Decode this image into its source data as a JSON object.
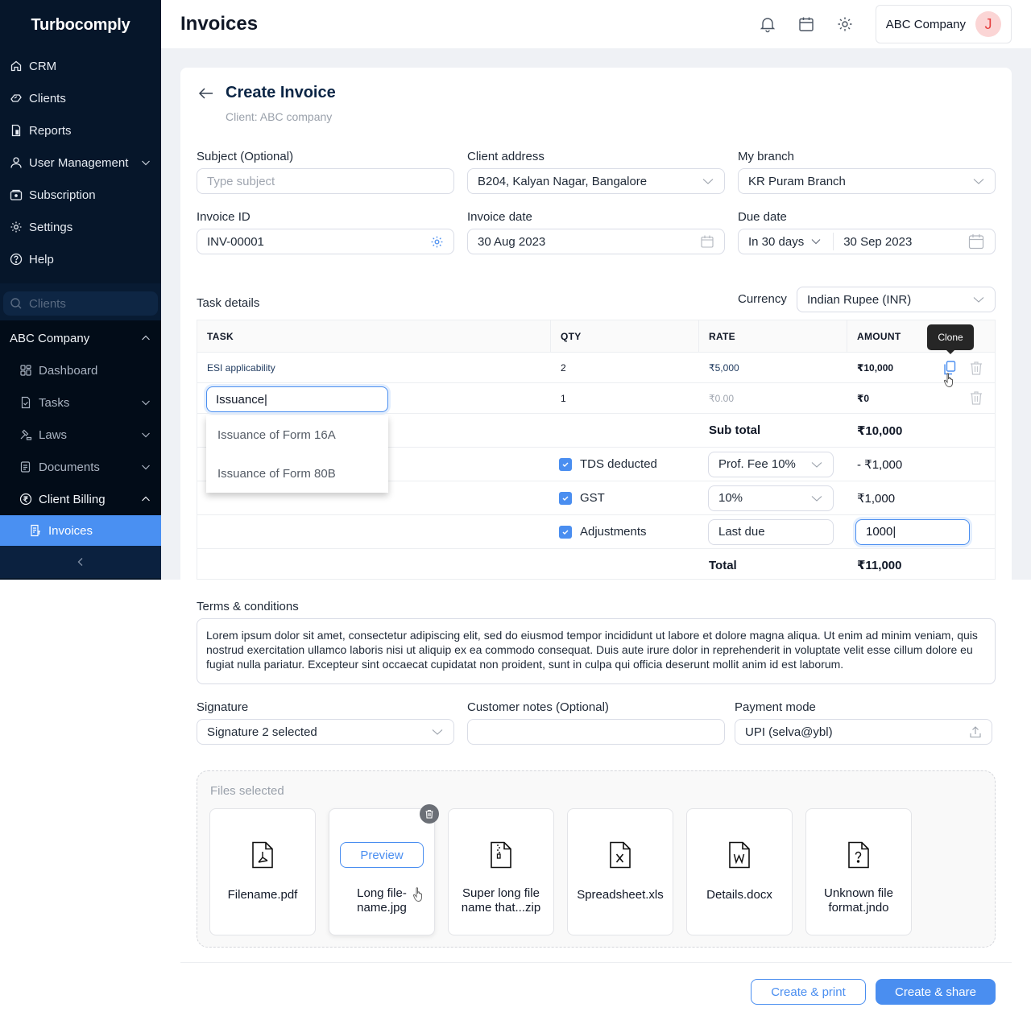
{
  "app": {
    "brand": "Turbocomply",
    "page_title": "Invoices"
  },
  "sidebar": {
    "items": [
      {
        "label": "CRM",
        "icon": "home-icon"
      },
      {
        "label": "Clients",
        "icon": "handshake-icon"
      },
      {
        "label": "Reports",
        "icon": "report-icon"
      },
      {
        "label": "User Management",
        "icon": "user-icon",
        "expandable": true
      },
      {
        "label": "Subscription",
        "icon": "subscription-icon"
      },
      {
        "label": "Settings",
        "icon": "gear-icon"
      },
      {
        "label": "Help",
        "icon": "help-icon"
      }
    ],
    "search_placeholder": "Clients",
    "company": {
      "name": "ABC Company",
      "items": [
        {
          "label": "Dashboard",
          "icon": "dashboard-icon"
        },
        {
          "label": "Tasks",
          "icon": "tasks-icon"
        },
        {
          "label": "Laws",
          "icon": "gavel-icon"
        },
        {
          "label": "Documents",
          "icon": "documents-icon"
        },
        {
          "label": "Client Billing",
          "icon": "rupee-icon"
        }
      ],
      "active_sub_item": "Invoices"
    }
  },
  "header": {
    "account_name": "ABC Company",
    "avatar_initial": "J"
  },
  "form": {
    "title": "Create Invoice",
    "client_label": "Client: ABC company",
    "subject": {
      "label": "Subject (Optional)",
      "placeholder": "Type subject",
      "value": ""
    },
    "client_address": {
      "label": "Client address",
      "value": "B204, Kalyan Nagar, Bangalore"
    },
    "branch": {
      "label": "My branch",
      "value": "KR Puram Branch"
    },
    "invoice_id": {
      "label": "Invoice ID",
      "value": "INV-00001"
    },
    "invoice_date": {
      "label": "Invoice date",
      "value": "30 Aug 2023"
    },
    "due_date": {
      "label": "Due date",
      "term": "In 30 days",
      "value": "30 Sep 2023"
    },
    "task_details_label": "Task details",
    "currency": {
      "label": "Currency",
      "value": "Indian Rupee (INR)"
    }
  },
  "table": {
    "columns": [
      "TASK",
      "QTY",
      "RATE",
      "AMOUNT"
    ],
    "rows": [
      {
        "task": "ESI applicability",
        "qty": "2",
        "rate": "₹5,000",
        "amount": "₹10,000"
      },
      {
        "task": "Issuance|",
        "qty": "1",
        "rate": "₹0.00",
        "amount": "₹0"
      }
    ],
    "suggestions": [
      "Issuance of Form 16A",
      "Issuance of Form 80B"
    ],
    "tooltip": "Clone",
    "subtotal_label": "Sub total",
    "subtotal": "₹10,000",
    "tds": {
      "label": "TDS deducted",
      "checked": true,
      "option": "Prof. Fee 10%",
      "amount": "- ₹1,000"
    },
    "gst": {
      "label": "GST",
      "checked": true,
      "option": "10%",
      "amount": "₹1,000"
    },
    "adjustments": {
      "label": "Adjustments",
      "checked": true,
      "note": "Last due",
      "value": "1000|"
    },
    "total_label": "Total",
    "total": "₹11,000"
  },
  "terms": {
    "label": "Terms & conditions",
    "text": "Lorem ipsum dolor sit amet, consectetur adipiscing elit, sed do eiusmod tempor incididunt ut labore et dolore magna aliqua. Ut enim ad minim veniam, quis nostrud exercitation ullamco laboris nisi ut aliquip ex ea commodo consequat. Duis aute irure dolor in reprehenderit in voluptate velit esse cillum dolore eu fugiat nulla pariatur. Excepteur sint occaecat cupidatat non proident, sunt in culpa qui officia deserunt mollit anim id est laborum."
  },
  "signature": {
    "label": "Signature",
    "value": "Signature 2 selected"
  },
  "customer_notes": {
    "label": "Customer notes (Optional)",
    "value": ""
  },
  "payment_mode": {
    "label": "Payment mode",
    "value": "UPI (selva@ybl)"
  },
  "files": {
    "label": "Files selected",
    "preview_label": "Preview",
    "items": [
      {
        "name": "Filename.pdf",
        "type": "pdf"
      },
      {
        "name": "Long file-name.jpg",
        "type": "jpg"
      },
      {
        "name": "Super long file name that...zip",
        "type": "zip"
      },
      {
        "name": "Spreadsheet.xls",
        "type": "xls"
      },
      {
        "name": "Details.docx",
        "type": "docx"
      },
      {
        "name": "Unknown file format.jndo",
        "type": "unknown"
      }
    ]
  },
  "actions": {
    "create_print": "Create & print",
    "create_share": "Create & share"
  },
  "colors": {
    "accent": "#4a8ef0",
    "sidebar_bg": "#06162a",
    "active_nav": "#4a90f2",
    "avatar_bg": "#fbd5d5",
    "avatar_fg": "#e53e3e"
  }
}
